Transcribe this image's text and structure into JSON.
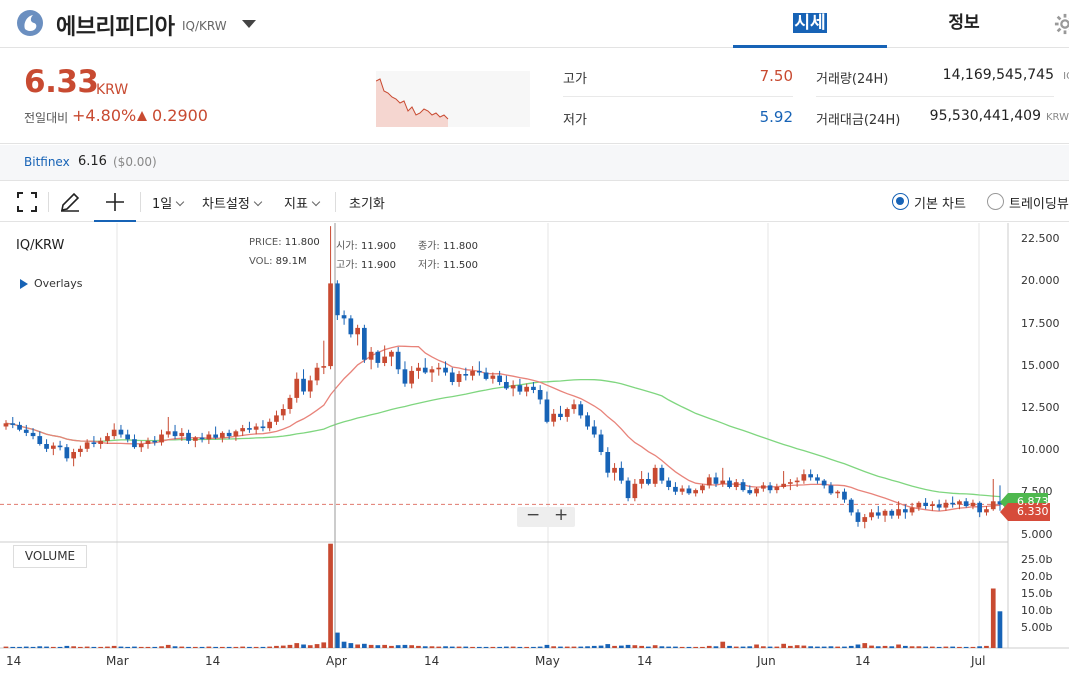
{
  "header": {
    "coin_name": "에브리피디아",
    "pair": "IQ/KRW",
    "tabs": [
      {
        "label": "시세",
        "active": true
      },
      {
        "label": "정보",
        "active": false
      }
    ]
  },
  "summary": {
    "price": "6.33",
    "unit": "KRW",
    "change_label": "전일대비",
    "change_rate": "+4.80%",
    "change_amount": "0.2900",
    "stats": {
      "high": {
        "label": "고가",
        "value": "7.50"
      },
      "low": {
        "label": "저가",
        "value": "5.92"
      },
      "volume": {
        "label": "거래량(24H)",
        "value": "14,169,545,745",
        "unit": "IQ"
      },
      "turnover": {
        "label": "거래대금(24H)",
        "value": "95,530,441,409",
        "unit": "KRW"
      }
    }
  },
  "exchange": {
    "name": "Bitfinex",
    "price": "6.16",
    "usd": "($0.00)"
  },
  "toolbar": {
    "interval": "1일",
    "chart_settings": "차트설정",
    "indicators": "지표",
    "reset": "초기화",
    "basic_chart": "기본 차트",
    "trading_view": "트레이딩뷰"
  },
  "chart_info": {
    "pair_label": "IQ/KRW",
    "overlays": "Overlays",
    "volume_label": "VOLUME",
    "ohlc": {
      "price_k": "PRICE:",
      "price": "11.800",
      "open_k": "시가:",
      "open": "11.900",
      "close_k": "종가:",
      "close": "11.800",
      "vol_k": "VOL:",
      "vol": "89.1M",
      "high_k": "고가:",
      "high": "11.900",
      "low_k": "저가:",
      "low": "11.500"
    },
    "zoom_out": "−",
    "zoom_in": "+",
    "last_price_tag": "6.330",
    "ma_tag": "6.873",
    "y_ticks": [
      "22.500",
      "20.000",
      "17.500",
      "15.000",
      "12.500",
      "10.000",
      "7.500",
      "5.000"
    ],
    "vol_ticks": [
      "25.0b",
      "20.0b",
      "15.0b",
      "10.0b",
      "5.00b"
    ],
    "x_ticks": [
      "14",
      "Mar",
      "14",
      "Apr",
      "14",
      "May",
      "14",
      "Jun",
      "14",
      "Jul"
    ]
  },
  "colors": {
    "up": "#c84a31",
    "down": "#1763b6",
    "accent": "#1763b6",
    "ma_short": "#e8837a",
    "ma_long": "#7fd67f"
  },
  "chart_data": {
    "type": "candlestick",
    "price_range": [
      4,
      24
    ],
    "volume_range": [
      0,
      30
    ],
    "volume_unit": "b",
    "candles": [
      [
        11.2,
        11.6,
        11.0,
        11.4,
        0.4
      ],
      [
        11.4,
        11.8,
        11.1,
        11.3,
        0.3
      ],
      [
        11.3,
        11.5,
        10.9,
        11.0,
        0.3
      ],
      [
        11.0,
        11.3,
        10.6,
        10.8,
        0.4
      ],
      [
        10.8,
        11.1,
        10.4,
        10.6,
        0.3
      ],
      [
        10.6,
        10.9,
        10.0,
        10.1,
        0.5
      ],
      [
        10.1,
        10.4,
        9.6,
        9.8,
        0.4
      ],
      [
        9.8,
        10.2,
        9.4,
        10.0,
        0.3
      ],
      [
        10.0,
        10.3,
        9.7,
        9.9,
        0.3
      ],
      [
        9.9,
        10.1,
        9.0,
        9.2,
        0.6
      ],
      [
        9.2,
        9.8,
        8.7,
        9.6,
        0.5
      ],
      [
        9.6,
        10.0,
        9.3,
        9.8,
        0.3
      ],
      [
        9.8,
        10.4,
        9.6,
        10.2,
        0.4
      ],
      [
        10.2,
        10.6,
        9.9,
        10.1,
        0.3
      ],
      [
        10.1,
        10.5,
        9.8,
        10.3,
        0.3
      ],
      [
        10.3,
        10.8,
        10.1,
        10.6,
        0.4
      ],
      [
        10.6,
        11.4,
        10.4,
        11.0,
        0.6
      ],
      [
        11.0,
        11.3,
        10.5,
        10.7,
        0.4
      ],
      [
        10.7,
        11.0,
        10.2,
        10.4,
        0.3
      ],
      [
        10.4,
        10.7,
        9.8,
        9.9,
        0.4
      ],
      [
        9.9,
        10.3,
        9.6,
        10.1,
        0.3
      ],
      [
        10.1,
        10.5,
        9.8,
        10.3,
        0.3
      ],
      [
        10.3,
        10.6,
        10.0,
        10.2,
        0.3
      ],
      [
        10.2,
        11.0,
        10.0,
        10.7,
        0.5
      ],
      [
        10.7,
        11.8,
        10.5,
        10.9,
        0.9
      ],
      [
        10.9,
        11.3,
        10.4,
        10.6,
        0.5
      ],
      [
        10.6,
        11.1,
        10.3,
        10.8,
        0.4
      ],
      [
        10.8,
        11.0,
        10.1,
        10.3,
        0.3
      ],
      [
        10.3,
        10.6,
        9.9,
        10.5,
        0.3
      ],
      [
        10.5,
        10.8,
        10.2,
        10.4,
        0.3
      ],
      [
        10.4,
        10.9,
        10.1,
        10.7,
        0.4
      ],
      [
        10.7,
        11.2,
        10.4,
        10.5,
        0.3
      ],
      [
        10.5,
        10.9,
        10.2,
        10.8,
        0.3
      ],
      [
        10.8,
        11.0,
        10.4,
        10.6,
        0.3
      ],
      [
        10.6,
        11.0,
        10.3,
        10.9,
        0.3
      ],
      [
        10.9,
        11.3,
        10.6,
        11.1,
        0.4
      ],
      [
        11.1,
        11.5,
        10.8,
        11.0,
        0.3
      ],
      [
        11.0,
        11.4,
        10.7,
        11.2,
        0.3
      ],
      [
        11.2,
        11.6,
        10.9,
        11.1,
        0.3
      ],
      [
        11.1,
        11.7,
        10.9,
        11.5,
        0.4
      ],
      [
        11.5,
        12.2,
        11.3,
        11.9,
        0.6
      ],
      [
        11.9,
        12.6,
        11.6,
        12.3,
        0.7
      ],
      [
        12.3,
        13.2,
        12.0,
        13.0,
        0.9
      ],
      [
        13.0,
        14.6,
        12.7,
        14.2,
        1.4
      ],
      [
        14.2,
        14.8,
        13.2,
        13.4,
        1.0
      ],
      [
        13.4,
        14.4,
        13.0,
        14.1,
        0.8
      ],
      [
        14.1,
        15.2,
        13.8,
        14.9,
        1.1
      ],
      [
        14.9,
        16.6,
        14.5,
        15.0,
        1.6
      ],
      [
        15.0,
        23.8,
        14.8,
        20.2,
        29.8
      ],
      [
        20.2,
        20.4,
        17.9,
        18.2,
        4.4
      ],
      [
        18.2,
        18.5,
        17.6,
        18.0,
        1.8
      ],
      [
        18.0,
        18.2,
        16.8,
        17.0,
        1.4
      ],
      [
        17.0,
        17.6,
        16.3,
        17.4,
        1.0
      ],
      [
        17.4,
        17.6,
        15.2,
        15.4,
        1.2
      ],
      [
        15.4,
        16.2,
        14.8,
        15.9,
        0.9
      ],
      [
        15.9,
        16.0,
        14.9,
        15.2,
        0.8
      ],
      [
        15.2,
        16.3,
        15.0,
        15.6,
        0.9
      ],
      [
        15.6,
        16.0,
        15.0,
        15.9,
        0.6
      ],
      [
        15.9,
        16.2,
        14.5,
        14.8,
        0.8
      ],
      [
        14.8,
        15.3,
        13.7,
        13.9,
        0.9
      ],
      [
        13.9,
        15.0,
        13.6,
        14.7,
        0.8
      ],
      [
        14.7,
        15.2,
        14.2,
        14.9,
        0.6
      ],
      [
        14.9,
        15.5,
        14.5,
        14.6,
        0.5
      ],
      [
        14.6,
        15.0,
        14.0,
        14.8,
        0.5
      ],
      [
        14.8,
        15.2,
        14.4,
        14.9,
        0.4
      ],
      [
        14.9,
        15.3,
        14.4,
        14.6,
        0.5
      ],
      [
        14.6,
        14.9,
        13.8,
        14.0,
        0.4
      ],
      [
        14.0,
        14.7,
        13.7,
        14.5,
        0.4
      ],
      [
        14.5,
        14.9,
        14.1,
        14.4,
        0.4
      ],
      [
        14.4,
        15.0,
        14.1,
        14.7,
        0.3
      ],
      [
        14.7,
        15.3,
        14.4,
        14.6,
        0.3
      ],
      [
        14.6,
        14.9,
        14.1,
        14.2,
        0.3
      ],
      [
        14.2,
        14.6,
        13.9,
        14.4,
        0.3
      ],
      [
        14.4,
        14.7,
        13.8,
        14.0,
        0.3
      ],
      [
        14.0,
        14.4,
        13.5,
        13.6,
        0.4
      ],
      [
        13.6,
        14.1,
        13.1,
        13.8,
        0.4
      ],
      [
        13.8,
        14.2,
        13.2,
        13.4,
        0.3
      ],
      [
        13.4,
        13.9,
        13.1,
        13.7,
        0.3
      ],
      [
        13.7,
        14.0,
        13.3,
        13.5,
        0.3
      ],
      [
        13.5,
        13.8,
        12.6,
        12.9,
        0.4
      ],
      [
        12.9,
        13.4,
        11.4,
        11.5,
        0.9
      ],
      [
        11.5,
        12.3,
        11.2,
        12.0,
        0.5
      ],
      [
        12.0,
        12.5,
        11.6,
        11.8,
        0.4
      ],
      [
        11.8,
        12.4,
        11.5,
        12.3,
        0.4
      ],
      [
        12.3,
        12.9,
        12.0,
        12.6,
        0.4
      ],
      [
        12.6,
        12.8,
        11.7,
        11.9,
        0.4
      ],
      [
        11.9,
        12.1,
        11.0,
        11.2,
        0.5
      ],
      [
        11.2,
        11.6,
        10.5,
        10.7,
        0.6
      ],
      [
        10.7,
        11.0,
        9.4,
        9.6,
        0.7
      ],
      [
        9.6,
        9.9,
        8.0,
        8.3,
        1.1
      ],
      [
        8.3,
        8.9,
        7.8,
        8.6,
        0.6
      ],
      [
        8.6,
        9.0,
        7.6,
        7.8,
        0.7
      ],
      [
        7.8,
        8.0,
        6.5,
        6.7,
        0.9
      ],
      [
        6.7,
        7.9,
        6.5,
        7.6,
        0.8
      ],
      [
        7.6,
        8.4,
        7.3,
        7.9,
        0.6
      ],
      [
        7.9,
        8.3,
        7.5,
        7.6,
        0.4
      ],
      [
        7.6,
        8.8,
        7.4,
        8.6,
        0.8
      ],
      [
        8.6,
        8.8,
        7.6,
        7.8,
        0.5
      ],
      [
        7.8,
        8.0,
        7.2,
        7.4,
        0.4
      ],
      [
        7.4,
        7.7,
        6.9,
        7.1,
        0.4
      ],
      [
        7.1,
        7.5,
        6.9,
        7.3,
        0.3
      ],
      [
        7.3,
        7.5,
        6.9,
        7.0,
        0.3
      ],
      [
        7.0,
        7.3,
        6.8,
        7.2,
        0.3
      ],
      [
        7.2,
        7.6,
        7.0,
        7.5,
        0.3
      ],
      [
        7.5,
        8.2,
        7.3,
        8.0,
        0.6
      ],
      [
        8.0,
        8.3,
        7.4,
        7.6,
        0.5
      ],
      [
        7.6,
        8.6,
        7.4,
        7.8,
        1.8
      ],
      [
        7.8,
        8.0,
        7.3,
        7.4,
        0.6
      ],
      [
        7.4,
        7.9,
        7.2,
        7.7,
        0.4
      ],
      [
        7.7,
        7.9,
        7.1,
        7.2,
        0.4
      ],
      [
        7.2,
        7.5,
        6.9,
        7.0,
        0.5
      ],
      [
        7.0,
        7.4,
        6.8,
        7.3,
        1.0
      ],
      [
        7.3,
        7.7,
        7.1,
        7.5,
        0.5
      ],
      [
        7.5,
        7.7,
        7.0,
        7.2,
        0.4
      ],
      [
        7.2,
        7.6,
        7.0,
        7.4,
        0.4
      ],
      [
        7.4,
        8.4,
        7.3,
        7.6,
        1.2
      ],
      [
        7.6,
        7.9,
        7.2,
        7.7,
        0.6
      ],
      [
        7.7,
        8.0,
        7.4,
        7.8,
        0.8
      ],
      [
        7.8,
        8.5,
        7.6,
        8.2,
        0.7
      ],
      [
        8.2,
        8.5,
        7.8,
        8.0,
        0.5
      ],
      [
        8.0,
        8.2,
        7.6,
        7.8,
        0.4
      ],
      [
        7.8,
        7.9,
        7.3,
        7.5,
        0.4
      ],
      [
        7.5,
        7.7,
        6.9,
        7.0,
        0.5
      ],
      [
        7.0,
        7.2,
        6.7,
        7.1,
        0.4
      ],
      [
        7.1,
        7.3,
        6.4,
        6.6,
        0.4
      ],
      [
        6.6,
        6.7,
        5.6,
        5.8,
        0.6
      ],
      [
        5.8,
        6.0,
        4.9,
        5.2,
        1.0
      ],
      [
        5.2,
        5.7,
        4.8,
        5.5,
        1.4
      ],
      [
        5.5,
        6.0,
        5.3,
        5.8,
        0.7
      ],
      [
        5.8,
        6.2,
        5.4,
        5.6,
        0.5
      ],
      [
        5.6,
        6.0,
        5.2,
        5.9,
        0.6
      ],
      [
        5.9,
        6.0,
        5.4,
        5.6,
        0.5
      ],
      [
        5.6,
        6.5,
        5.4,
        6.0,
        1.0
      ],
      [
        6.0,
        6.3,
        5.4,
        5.8,
        0.6
      ],
      [
        5.8,
        6.4,
        5.6,
        6.1,
        0.5
      ],
      [
        6.1,
        6.5,
        5.9,
        6.4,
        0.5
      ],
      [
        6.4,
        6.7,
        6.0,
        6.2,
        0.4
      ],
      [
        6.2,
        6.5,
        5.9,
        6.3,
        0.4
      ],
      [
        6.3,
        6.6,
        5.9,
        6.1,
        0.3
      ],
      [
        6.1,
        6.6,
        5.9,
        6.4,
        0.4
      ],
      [
        6.4,
        6.8,
        6.1,
        6.3,
        0.4
      ],
      [
        6.3,
        6.6,
        6.0,
        6.5,
        0.3
      ],
      [
        6.5,
        6.7,
        6.1,
        6.2,
        0.3
      ],
      [
        6.2,
        6.6,
        6.0,
        6.4,
        0.3
      ],
      [
        6.4,
        6.5,
        5.5,
        5.8,
        0.5
      ],
      [
        5.8,
        6.2,
        5.6,
        6.0,
        0.6
      ],
      [
        6.0,
        7.9,
        5.9,
        6.5,
        17.0
      ],
      [
        6.5,
        7.5,
        5.9,
        6.3,
        10.5
      ]
    ],
    "ma_short_end": 6.2,
    "ma_long_end": 6.873
  }
}
